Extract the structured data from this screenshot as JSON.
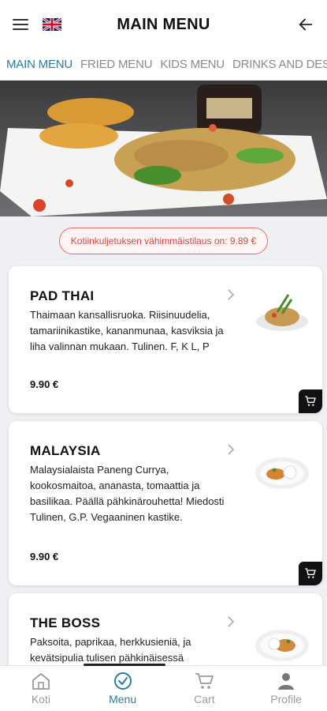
{
  "header": {
    "title": "MAIN MENU",
    "menu_icon": "hamburger-icon",
    "language_icon": "uk-flag-icon",
    "back_icon": "arrow-left-icon"
  },
  "tabs": [
    {
      "label": "MAIN MENU",
      "active": true
    },
    {
      "label": "FRIED MENU",
      "active": false
    },
    {
      "label": "KIDS MENU",
      "active": false
    },
    {
      "label": "DRINKS AND DESSE",
      "active": false
    }
  ],
  "notice": {
    "min_order": "Kotiinkuljetuksen vähimmäistilaus on: 9.89 €"
  },
  "menu_items": [
    {
      "name": "PAD THAI",
      "description": "Thaimaan kansallisruoka. Riisinuudelia, tamariinikastike, kananmunaa, kasviksia ja liha valinnan mukaan. Tulinen. F, K L, P",
      "price": "9.90 €"
    },
    {
      "name": "MALAYSIA",
      "description": "Malaysialaista Paneng Curryа, kookosmaitoa, ananasta, tomaattia ja basilikaa. Päällä pähkinärouhetta! Miedosti Tulinen, G.P. Vegaaninen kastike.",
      "price": "9.90 €"
    },
    {
      "name": "THE BOSS",
      "description": "Paksoita, paprikaa, herkkusieniä, ja kevätsipulia tulisen pähkinäisessä",
      "price": ""
    }
  ],
  "bottom_nav": [
    {
      "label": "Koti",
      "icon": "home-icon",
      "active": false
    },
    {
      "label": "Menu",
      "icon": "check-circle-icon",
      "active": true
    },
    {
      "label": "Cart",
      "icon": "cart-icon",
      "active": false
    },
    {
      "label": "Profile",
      "icon": "user-icon",
      "active": false
    }
  ],
  "colors": {
    "accent": "#2a7da0",
    "notice_red": "#d64646",
    "background": "#eef0f3"
  }
}
